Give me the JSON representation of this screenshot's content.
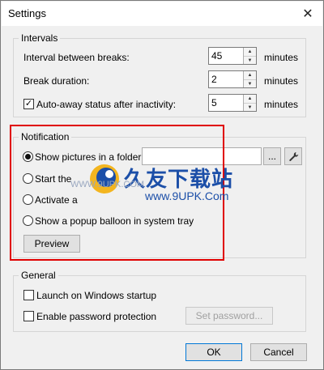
{
  "window": {
    "title": "Settings"
  },
  "intervals": {
    "legend": "Intervals",
    "interval_label": "Interval between breaks:",
    "interval_value": "45",
    "duration_label": "Break duration:",
    "duration_value": "2",
    "autoaway_label": "Auto-away status after inactivity:",
    "autoaway_value": "5",
    "autoaway_checked": true,
    "unit": "minutes"
  },
  "notification": {
    "legend": "Notification",
    "options": [
      {
        "label": "Show pictures in a folder:",
        "selected": true
      },
      {
        "label": "Start the",
        "selected": false
      },
      {
        "label": "Activate a",
        "selected": false
      },
      {
        "label": "Show a popup balloon in system tray",
        "selected": false
      }
    ],
    "browse_label": "...",
    "preview_label": "Preview"
  },
  "general": {
    "legend": "General",
    "launch_label": "Launch on Windows startup",
    "password_label": "Enable password protection",
    "set_password_label": "Set password..."
  },
  "buttons": {
    "ok": "OK",
    "cancel": "Cancel"
  },
  "watermark": {
    "brand": "久友下载站",
    "url": "www.9UPK.Com",
    "url_small": "WWW.9UPK.COM"
  },
  "colors": {
    "highlight": "#e00000",
    "accent": "#0078d7",
    "watermark": "#1c4fa8"
  }
}
